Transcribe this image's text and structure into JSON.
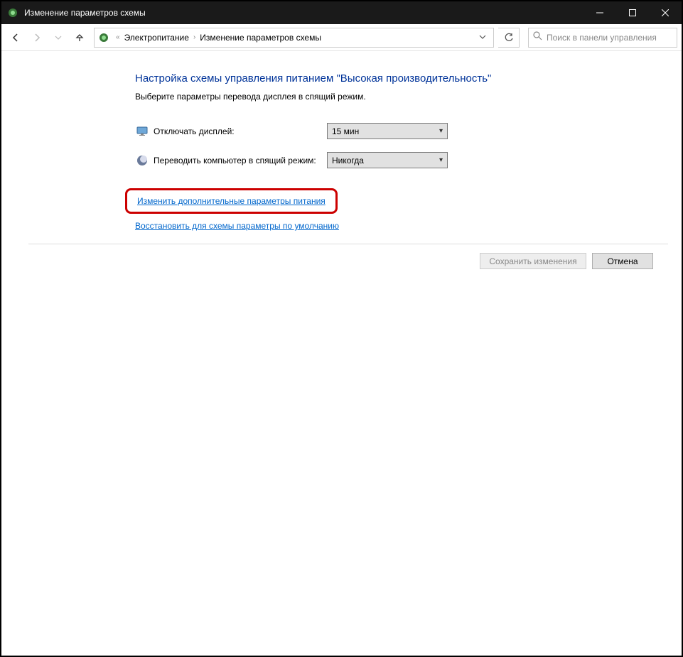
{
  "window": {
    "title": "Изменение параметров схемы"
  },
  "breadcrumb": {
    "item1": "Электропитание",
    "item2": "Изменение параметров схемы"
  },
  "search": {
    "placeholder": "Поиск в панели управления"
  },
  "page": {
    "heading": "Настройка схемы управления питанием \"Высокая производительность\"",
    "subtext": "Выберите параметры перевода дисплея в спящий режим."
  },
  "settings": {
    "display_off": {
      "label": "Отключать дисплей:",
      "value": "15 мин"
    },
    "sleep": {
      "label": "Переводить компьютер в спящий режим:",
      "value": "Никогда"
    }
  },
  "links": {
    "advanced": "Изменить дополнительные параметры питания",
    "restore": "Восстановить для схемы параметры по умолчанию"
  },
  "buttons": {
    "save": "Сохранить изменения",
    "cancel": "Отмена"
  }
}
